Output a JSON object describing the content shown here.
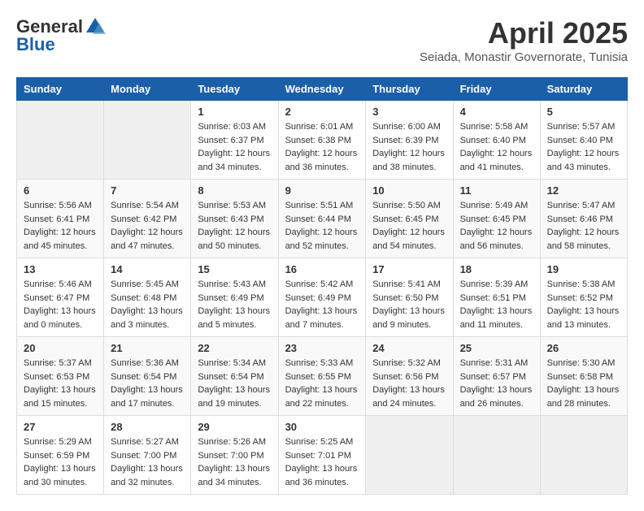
{
  "header": {
    "logo_general": "General",
    "logo_blue": "Blue",
    "month_year": "April 2025",
    "location": "Seiada, Monastir Governorate, Tunisia"
  },
  "weekdays": [
    "Sunday",
    "Monday",
    "Tuesday",
    "Wednesday",
    "Thursday",
    "Friday",
    "Saturday"
  ],
  "weeks": [
    [
      {
        "day": "",
        "sunrise": "",
        "sunset": "",
        "daylight": ""
      },
      {
        "day": "",
        "sunrise": "",
        "sunset": "",
        "daylight": ""
      },
      {
        "day": "1",
        "sunrise": "Sunrise: 6:03 AM",
        "sunset": "Sunset: 6:37 PM",
        "daylight": "Daylight: 12 hours and 34 minutes."
      },
      {
        "day": "2",
        "sunrise": "Sunrise: 6:01 AM",
        "sunset": "Sunset: 6:38 PM",
        "daylight": "Daylight: 12 hours and 36 minutes."
      },
      {
        "day": "3",
        "sunrise": "Sunrise: 6:00 AM",
        "sunset": "Sunset: 6:39 PM",
        "daylight": "Daylight: 12 hours and 38 minutes."
      },
      {
        "day": "4",
        "sunrise": "Sunrise: 5:58 AM",
        "sunset": "Sunset: 6:40 PM",
        "daylight": "Daylight: 12 hours and 41 minutes."
      },
      {
        "day": "5",
        "sunrise": "Sunrise: 5:57 AM",
        "sunset": "Sunset: 6:40 PM",
        "daylight": "Daylight: 12 hours and 43 minutes."
      }
    ],
    [
      {
        "day": "6",
        "sunrise": "Sunrise: 5:56 AM",
        "sunset": "Sunset: 6:41 PM",
        "daylight": "Daylight: 12 hours and 45 minutes."
      },
      {
        "day": "7",
        "sunrise": "Sunrise: 5:54 AM",
        "sunset": "Sunset: 6:42 PM",
        "daylight": "Daylight: 12 hours and 47 minutes."
      },
      {
        "day": "8",
        "sunrise": "Sunrise: 5:53 AM",
        "sunset": "Sunset: 6:43 PM",
        "daylight": "Daylight: 12 hours and 50 minutes."
      },
      {
        "day": "9",
        "sunrise": "Sunrise: 5:51 AM",
        "sunset": "Sunset: 6:44 PM",
        "daylight": "Daylight: 12 hours and 52 minutes."
      },
      {
        "day": "10",
        "sunrise": "Sunrise: 5:50 AM",
        "sunset": "Sunset: 6:45 PM",
        "daylight": "Daylight: 12 hours and 54 minutes."
      },
      {
        "day": "11",
        "sunrise": "Sunrise: 5:49 AM",
        "sunset": "Sunset: 6:45 PM",
        "daylight": "Daylight: 12 hours and 56 minutes."
      },
      {
        "day": "12",
        "sunrise": "Sunrise: 5:47 AM",
        "sunset": "Sunset: 6:46 PM",
        "daylight": "Daylight: 12 hours and 58 minutes."
      }
    ],
    [
      {
        "day": "13",
        "sunrise": "Sunrise: 5:46 AM",
        "sunset": "Sunset: 6:47 PM",
        "daylight": "Daylight: 13 hours and 0 minutes."
      },
      {
        "day": "14",
        "sunrise": "Sunrise: 5:45 AM",
        "sunset": "Sunset: 6:48 PM",
        "daylight": "Daylight: 13 hours and 3 minutes."
      },
      {
        "day": "15",
        "sunrise": "Sunrise: 5:43 AM",
        "sunset": "Sunset: 6:49 PM",
        "daylight": "Daylight: 13 hours and 5 minutes."
      },
      {
        "day": "16",
        "sunrise": "Sunrise: 5:42 AM",
        "sunset": "Sunset: 6:49 PM",
        "daylight": "Daylight: 13 hours and 7 minutes."
      },
      {
        "day": "17",
        "sunrise": "Sunrise: 5:41 AM",
        "sunset": "Sunset: 6:50 PM",
        "daylight": "Daylight: 13 hours and 9 minutes."
      },
      {
        "day": "18",
        "sunrise": "Sunrise: 5:39 AM",
        "sunset": "Sunset: 6:51 PM",
        "daylight": "Daylight: 13 hours and 11 minutes."
      },
      {
        "day": "19",
        "sunrise": "Sunrise: 5:38 AM",
        "sunset": "Sunset: 6:52 PM",
        "daylight": "Daylight: 13 hours and 13 minutes."
      }
    ],
    [
      {
        "day": "20",
        "sunrise": "Sunrise: 5:37 AM",
        "sunset": "Sunset: 6:53 PM",
        "daylight": "Daylight: 13 hours and 15 minutes."
      },
      {
        "day": "21",
        "sunrise": "Sunrise: 5:36 AM",
        "sunset": "Sunset: 6:54 PM",
        "daylight": "Daylight: 13 hours and 17 minutes."
      },
      {
        "day": "22",
        "sunrise": "Sunrise: 5:34 AM",
        "sunset": "Sunset: 6:54 PM",
        "daylight": "Daylight: 13 hours and 19 minutes."
      },
      {
        "day": "23",
        "sunrise": "Sunrise: 5:33 AM",
        "sunset": "Sunset: 6:55 PM",
        "daylight": "Daylight: 13 hours and 22 minutes."
      },
      {
        "day": "24",
        "sunrise": "Sunrise: 5:32 AM",
        "sunset": "Sunset: 6:56 PM",
        "daylight": "Daylight: 13 hours and 24 minutes."
      },
      {
        "day": "25",
        "sunrise": "Sunrise: 5:31 AM",
        "sunset": "Sunset: 6:57 PM",
        "daylight": "Daylight: 13 hours and 26 minutes."
      },
      {
        "day": "26",
        "sunrise": "Sunrise: 5:30 AM",
        "sunset": "Sunset: 6:58 PM",
        "daylight": "Daylight: 13 hours and 28 minutes."
      }
    ],
    [
      {
        "day": "27",
        "sunrise": "Sunrise: 5:29 AM",
        "sunset": "Sunset: 6:59 PM",
        "daylight": "Daylight: 13 hours and 30 minutes."
      },
      {
        "day": "28",
        "sunrise": "Sunrise: 5:27 AM",
        "sunset": "Sunset: 7:00 PM",
        "daylight": "Daylight: 13 hours and 32 minutes."
      },
      {
        "day": "29",
        "sunrise": "Sunrise: 5:26 AM",
        "sunset": "Sunset: 7:00 PM",
        "daylight": "Daylight: 13 hours and 34 minutes."
      },
      {
        "day": "30",
        "sunrise": "Sunrise: 5:25 AM",
        "sunset": "Sunset: 7:01 PM",
        "daylight": "Daylight: 13 hours and 36 minutes."
      },
      {
        "day": "",
        "sunrise": "",
        "sunset": "",
        "daylight": ""
      },
      {
        "day": "",
        "sunrise": "",
        "sunset": "",
        "daylight": ""
      },
      {
        "day": "",
        "sunrise": "",
        "sunset": "",
        "daylight": ""
      }
    ]
  ]
}
